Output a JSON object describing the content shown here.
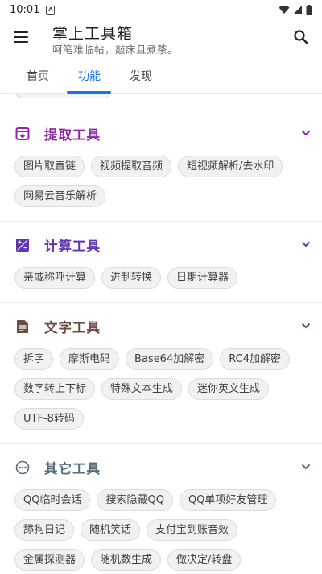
{
  "status_bar": {
    "time": "10:01",
    "notification_letter": "A"
  },
  "app_bar": {
    "title": "掌上工具箱",
    "subtitle": "呵笔难临帖，敲床且煮茶。"
  },
  "tabs": [
    {
      "label": "首页",
      "active": false
    },
    {
      "label": "功能",
      "active": true
    },
    {
      "label": "发现",
      "active": false
    }
  ],
  "colors": {
    "accent": "#1a73e8",
    "extract": "#8e24aa",
    "calc": "#5e35b1",
    "text": "#6d4c41",
    "other": "#546e7a"
  },
  "sections": {
    "extract": {
      "title": "提取工具",
      "icon": "archive-icon",
      "chips": [
        "图片取直链",
        "视频提取音频",
        "短视频解析/去水印",
        "网易云音乐解析"
      ]
    },
    "calc": {
      "title": "计算工具",
      "icon": "calculator-icon",
      "chips": [
        "亲戚称呼计算",
        "进制转换",
        "日期计算器"
      ]
    },
    "text": {
      "title": "文字工具",
      "icon": "document-icon",
      "chips": [
        "拆字",
        "摩斯电码",
        "Base64加解密",
        "RC4加解密",
        "数字转上下标",
        "特殊文本生成",
        "迷你英文生成",
        "UTF-8转码"
      ]
    },
    "other": {
      "title": "其它工具",
      "icon": "more-horiz-icon",
      "chips": [
        "QQ临时会话",
        "搜索隐藏QQ",
        "QQ单项好友管理",
        "舔狗日记",
        "随机笑话",
        "支付宝到账音效",
        "金属探测器",
        "随机数生成",
        "做决定/转盘"
      ]
    }
  }
}
